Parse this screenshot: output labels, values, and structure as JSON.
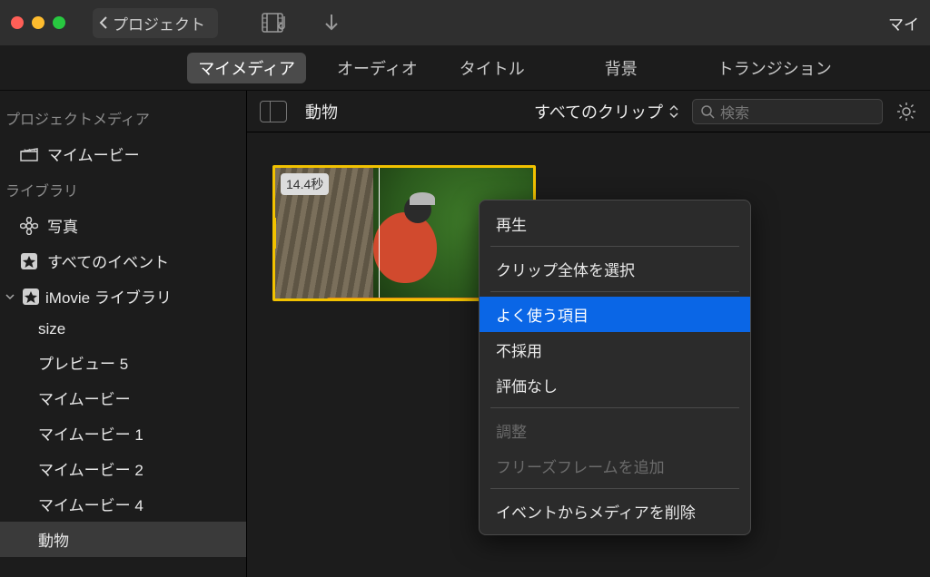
{
  "titlebar": {
    "back_label": "プロジェクト",
    "right_text": "マイ"
  },
  "tabs": {
    "media": "マイメディア",
    "audio": "オーディオ",
    "titles": "タイトル",
    "backgrounds": "背景",
    "transitions": "トランジション"
  },
  "sidebar": {
    "section_project_media": "プロジェクトメディア",
    "my_movie": "マイムービー",
    "section_libraries": "ライブラリ",
    "photos": "写真",
    "all_events": "すべてのイベント",
    "imovie_library": "iMovie ライブラリ",
    "items": {
      "size": "size",
      "preview5": "プレビュー 5",
      "mymovie": "マイムービー",
      "mymovie1": "マイムービー 1",
      "mymovie2": "マイムービー 2",
      "mymovie4": "マイムービー 4",
      "animals": "動物"
    }
  },
  "browser": {
    "title": "動物",
    "filter_label": "すべてのクリップ",
    "search_placeholder": "検索"
  },
  "clip": {
    "duration": "14.4秒"
  },
  "context_menu": {
    "play": "再生",
    "select_entire_clip": "クリップ全体を選択",
    "favorite": "よく使う項目",
    "reject": "不採用",
    "unrate": "評価なし",
    "adjust": "調整",
    "add_freeze_frame": "フリーズフレームを追加",
    "delete_media_from_event": "イベントからメディアを削除"
  },
  "icons": {
    "film_music": "film-music-icon",
    "import": "import-icon",
    "search": "search-icon",
    "gear": "gear-icon",
    "clapperboard": "clapperboard-icon",
    "flower": "flower-icon",
    "star": "star-icon"
  }
}
